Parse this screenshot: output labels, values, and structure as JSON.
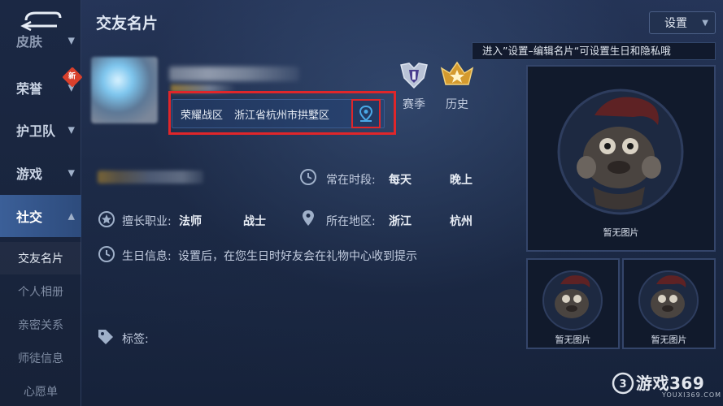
{
  "header": {
    "title": "交友名片",
    "settings_label": "设置",
    "tooltip": "进入”设置–编辑名片“可设置生日和隐私哦"
  },
  "sidebar": {
    "partial_item": "皮肤",
    "items": [
      {
        "label": "荣誉",
        "badge": "新"
      },
      {
        "label": "护卫队"
      },
      {
        "label": "游戏"
      },
      {
        "label": "社交"
      }
    ],
    "sub_items": [
      "交友名片",
      "个人相册",
      "亲密关系",
      "师徒信息",
      "心愿单"
    ]
  },
  "profile": {
    "zone": "荣耀战区",
    "location": "浙江省杭州市拱墅区",
    "badges": [
      "赛季",
      "历史"
    ]
  },
  "info": {
    "online_label": "常在时段:",
    "online_values": [
      "每天",
      "晚上"
    ],
    "role_label": "擅长职业:",
    "role_values": [
      "法师",
      "战士"
    ],
    "region_label": "所在地区:",
    "region_values": [
      "浙江",
      "杭州"
    ],
    "birthday_label": "生日信息:",
    "birthday_text": "设置后，在您生日时好友会在礼物中心收到提示",
    "tags_label": "标签:"
  },
  "photos": {
    "empty_caption": "暂无图片"
  },
  "watermark": {
    "text": "游戏369",
    "sub": "YOUXI369.COM"
  },
  "colors": {
    "highlight_red": "#e0262a",
    "accent_blue": "#4aa8e6",
    "active_nav": "#3b5f98"
  }
}
